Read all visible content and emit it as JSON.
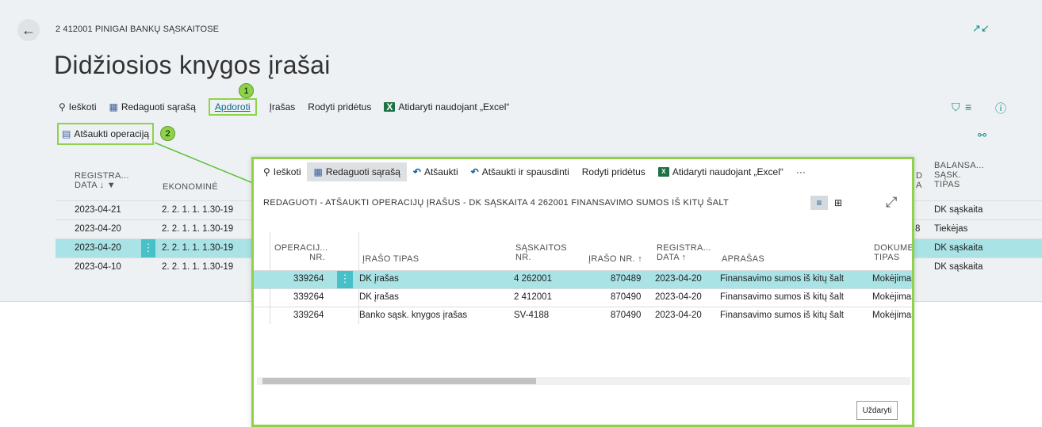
{
  "header": {
    "breadcrumb": "2 412001 PINIGAI BANKŲ SĄSKAITOSE",
    "title": "Didžiosios knygos įrašai"
  },
  "toolbar": {
    "search": "Ieškoti",
    "edit_list": "Redaguoti sąrašą",
    "process": "Apdoroti",
    "entry": "Įrašas",
    "show_attached": "Rodyti pridėtus",
    "open_excel": "Atidaryti naudojant „Excel“"
  },
  "annotations": {
    "badge1": "1",
    "badge2": "2"
  },
  "subaction": {
    "reverse_transaction": "Atšaukti operaciją"
  },
  "background_table": {
    "headers": {
      "reg_date_1": "REGISTRA...",
      "reg_date_2": "DATA ↓ ▼",
      "economic": "EKONOMINĖ",
      "bal_1": "BALANSA...",
      "bal_2": "SĄSK.",
      "bal_3": "TIPAS",
      "partial_d": "D",
      "partial_a": "A"
    },
    "rows": [
      {
        "date": "2023-04-21",
        "econ": "2. 2. 1. 1. 1.30-19",
        "bal": "DK sąskaita",
        "partial": ""
      },
      {
        "date": "2023-04-20",
        "econ": "2. 2. 1. 1. 1.30-19",
        "bal": "Tiekėjas",
        "partial": "8"
      },
      {
        "date": "2023-04-20",
        "econ": "2. 2. 1. 1. 1.30-19",
        "bal": "DK sąskaita",
        "partial": ""
      },
      {
        "date": "2023-04-10",
        "econ": "2. 2. 1. 1. 1.30-19",
        "bal": "DK sąskaita",
        "partial": ""
      }
    ]
  },
  "modal": {
    "toolbar": {
      "search": "Ieškoti",
      "edit_list": "Redaguoti sąrašą",
      "reverse": "Atšaukti",
      "reverse_print": "Atšaukti ir spausdinti",
      "show_attached": "Rodyti pridėtus",
      "open_excel": "Atidaryti naudojant „Excel“",
      "more": "···"
    },
    "title": "REDAGUOTI - ATŠAUKTI OPERACIJŲ ĮRAŠUS - DK SĄSKAITA 4 262001 FINANSAVIMO SUMOS IŠ KITŲ ŠALT",
    "headers": {
      "op_1": "OPERACIJ...",
      "op_2": "NR.",
      "type": "ĮRAŠO TIPAS",
      "acc_1": "SĄSKAITOS",
      "acc_2": "NR.",
      "entry_no": "ĮRAŠO NR. ↑",
      "reg_1": "REGISTRA...",
      "reg_2": "DATA ↑",
      "desc": "APRAŠAS",
      "doc_1": "DOKUMEN",
      "doc_2": "TIPAS"
    },
    "rows": [
      {
        "op": "339264",
        "type": "DK įrašas",
        "acc": "4 262001",
        "entry": "870489",
        "date": "2023-04-20",
        "desc": "Finansavimo sumos iš kitų šalt",
        "doc": "Mokėjimas"
      },
      {
        "op": "339264",
        "type": "DK įrašas",
        "acc": "2 412001",
        "entry": "870490",
        "date": "2023-04-20",
        "desc": "Finansavimo sumos iš kitų šalt",
        "doc": "Mokėjimas"
      },
      {
        "op": "339264",
        "type": "Banko sąsk. knygos įrašas",
        "acc": "SV-4188",
        "entry": "870490",
        "date": "2023-04-20",
        "desc": "Finansavimo sumos iš kitų šalt",
        "doc": "Mokėjimas"
      }
    ],
    "close": "Uždaryti"
  },
  "colors": {
    "accent": "#47c1c7",
    "selected_row": "#a9e3e6",
    "highlight": "#8ed24a"
  }
}
